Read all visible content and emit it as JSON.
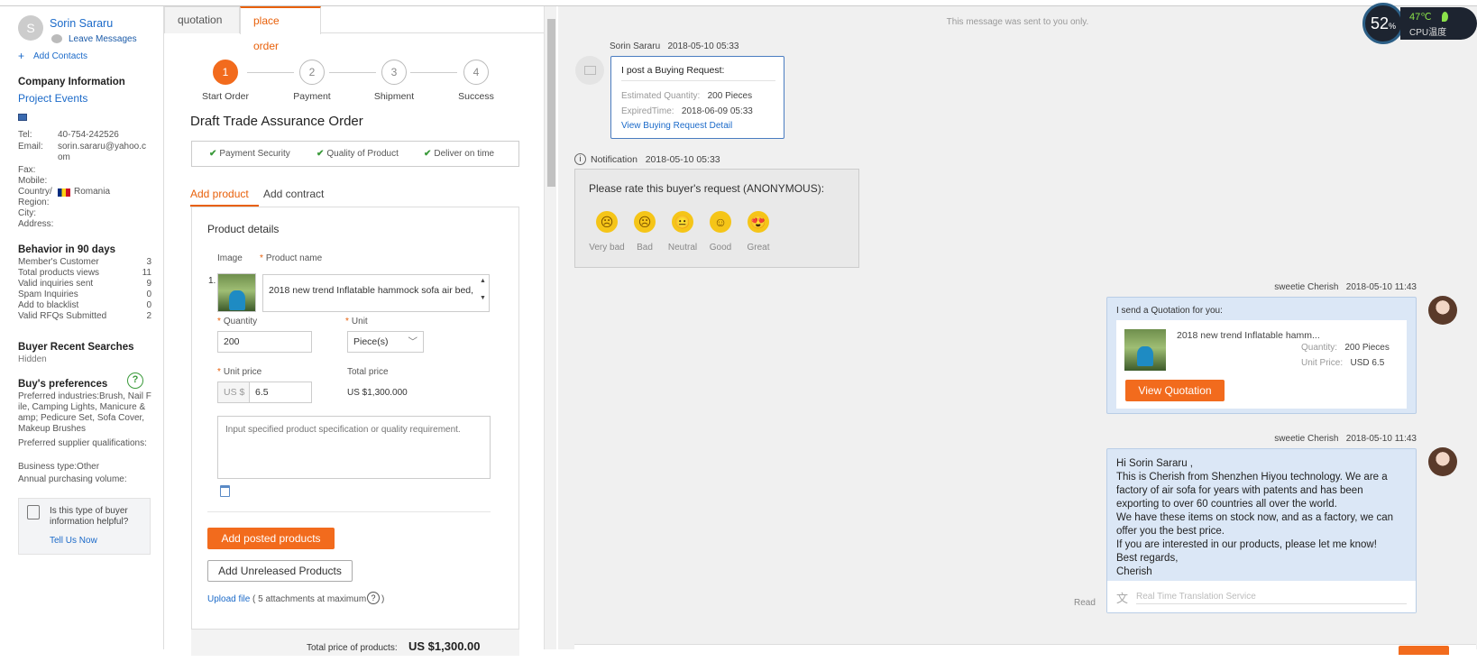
{
  "left": {
    "avatar_initial": "S",
    "name": "Sorin Sararu",
    "leave_messages": "Leave Messages",
    "add_contacts": "Add Contacts",
    "company_information": "Company Information",
    "project_events": "Project Events",
    "contact": [
      {
        "label": "Tel:",
        "value": "40-754-242526"
      },
      {
        "label": "Email:",
        "value": "sorin.sararu@yahoo.c om"
      },
      {
        "label": "Fax:",
        "value": ""
      },
      {
        "label": "Mobile:",
        "value": ""
      },
      {
        "label": "Country/",
        "value": "Romania"
      },
      {
        "label": "Region:",
        "value": ""
      },
      {
        "label": "City:",
        "value": ""
      },
      {
        "label": "Address:",
        "value": ""
      }
    ],
    "behavior_title": "Behavior in 90 days",
    "behavior": [
      {
        "label": "Member's Customer",
        "value": "3"
      },
      {
        "label": "Total products views",
        "value": "11"
      },
      {
        "label": "Valid inquiries sent",
        "value": "9"
      },
      {
        "label": "Spam Inquiries",
        "value": "0"
      },
      {
        "label": "Add to blacklist",
        "value": "0"
      },
      {
        "label": "Valid RFQs Submitted",
        "value": "2"
      }
    ],
    "recent_searches_title": "Buyer Recent Searches",
    "recent_searches_value": "Hidden",
    "preferences_title": "Buy's preferences",
    "preferences_text": "Preferred industries:Brush, Nail File, Camping Lights, Manicure & amp; Pedicure Set, Sofa Cover, Makeup Brushes",
    "supplier_qual": "Preferred supplier qualifications:",
    "business_type": "Business type:Other",
    "annual_volume": "Annual purchasing volume:",
    "helpful_text": "Is this type of buyer information helpful?",
    "tell_us": "Tell Us Now"
  },
  "mid": {
    "tabs": [
      "quotation",
      "place order"
    ],
    "steps": [
      "Start Order",
      "Payment",
      "Shipment",
      "Success"
    ],
    "step_nums": [
      "1",
      "2",
      "3",
      "4"
    ],
    "title": "Draft Trade Assurance Order",
    "guarantees": [
      "Payment Security",
      "Quality of Product",
      "Deliver on time"
    ],
    "subtabs": [
      "Add product",
      "Add contract"
    ],
    "product_details": "Product details",
    "col_image": "Image",
    "col_product_name": "Product name",
    "row_num": "1.",
    "product_name": "2018 new trend Inflatable hammock sofa air bed,",
    "quantity_label": "Quantity",
    "quantity_value": "200",
    "unit_label": "Unit",
    "unit_value": "Piece(s)",
    "unit_price_label": "Unit price",
    "currency": "US $",
    "unit_price_value": "6.5",
    "total_price_label": "Total price",
    "total_price_value": "US $1,300.000",
    "spec_placeholder": "Input specified product specification or quality requirement.",
    "add_posted": "Add posted products",
    "add_unreleased": "Add Unreleased Products",
    "upload_file": "Upload file",
    "attachments": "( 5 attachments at maximum",
    "total_products_label": "Total price of products:",
    "total_products_value": "US $1,300.00"
  },
  "right": {
    "system_note": "This message was sent to you only.",
    "msg1": {
      "sender": "Sorin Sararu",
      "time": "2018-05-10 05:33",
      "title": "I post a Buying Request:",
      "qty_label": "Estimated Quantity:",
      "qty_value": "200 Pieces",
      "exp_label": "ExpiredTime:",
      "exp_value": "2018-06-09 05:33",
      "link": "View Buying Request Detail"
    },
    "notification": {
      "label": "Notification",
      "time": "2018-05-10 05:33",
      "question": "Please rate this buyer's request (ANONYMOUS):",
      "ratings": [
        "Very bad",
        "Bad",
        "Neutral",
        "Good",
        "Great"
      ]
    },
    "msg2": {
      "sender": "sweetie Cherish",
      "time": "2018-05-10 11:43",
      "intro": "I send a Quotation for you:",
      "product": "2018 new trend Inflatable hamm...",
      "qty_label": "Quantity:",
      "qty_value": "200 Pieces",
      "price_label": "Unit Price:",
      "price_value": "USD 6.5",
      "button": "View Quotation"
    },
    "msg3": {
      "sender": "sweetie Cherish",
      "time": "2018-05-10 11:43",
      "lines": [
        "Hi Sorin Sararu ,",
        "This is Cherish from Shenzhen Hiyou technology. We are a",
        "factory of air sofa for years with patents and has been",
        "exporting to over 60 countries all over the world.",
        "We have these items on stock now, and as a factory, we can",
        "offer you the best price.",
        "If you are interested in our products, please let me know!",
        "Best regards,",
        "Cherish"
      ],
      "translate": "Real Time Translation Service",
      "read": "Read"
    }
  },
  "widget": {
    "percent": "52",
    "percent_sign": "%",
    "temp": "47℃",
    "cpu_label": "CPU温度"
  },
  "colors": {
    "accent": "#f26b1d",
    "link": "#1b6ac9",
    "bubble": "#dbe7f6"
  }
}
